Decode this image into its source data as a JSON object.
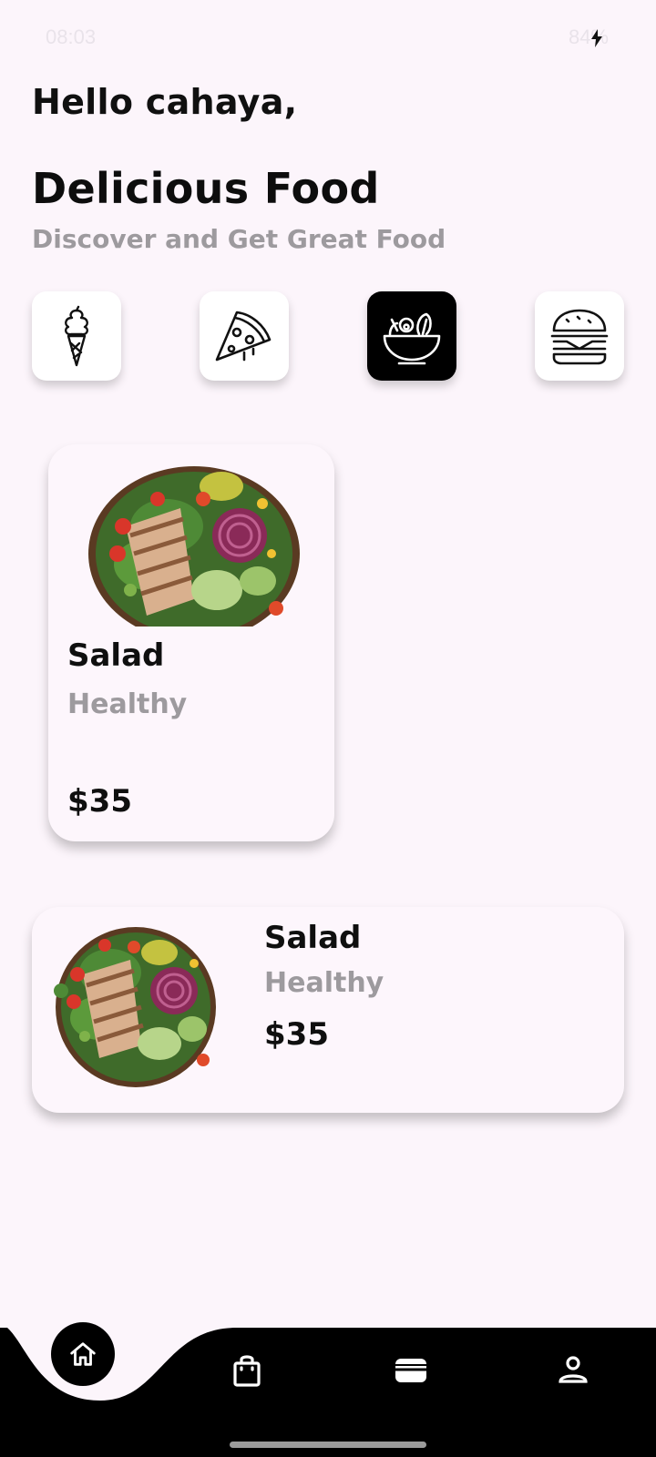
{
  "status_bar": {
    "time": "08:03",
    "right": "84%"
  },
  "header": {
    "greeting": "Hello cahaya,",
    "title": "Delicious Food",
    "subtitle": "Discover and Get Great Food"
  },
  "categories": [
    {
      "icon": "ice-cream-icon",
      "active": false
    },
    {
      "icon": "pizza-icon",
      "active": false
    },
    {
      "icon": "salad-bowl-icon",
      "active": true
    },
    {
      "icon": "burger-icon",
      "active": false
    }
  ],
  "featured_card": {
    "name": "Salad",
    "tag": "Healthy",
    "price": "$35",
    "image": "salad-image"
  },
  "list_card": {
    "name": "Salad",
    "tag": "Healthy",
    "price": "$35",
    "image": "salad-image"
  },
  "bottom_nav": {
    "items": [
      "home-icon",
      "shopping-bag-icon",
      "wallet-icon",
      "profile-icon"
    ],
    "active": "home-icon"
  },
  "colors": {
    "background": "#fcf5fb",
    "accent": "#000000",
    "muted_text": "#9d9a9e"
  }
}
